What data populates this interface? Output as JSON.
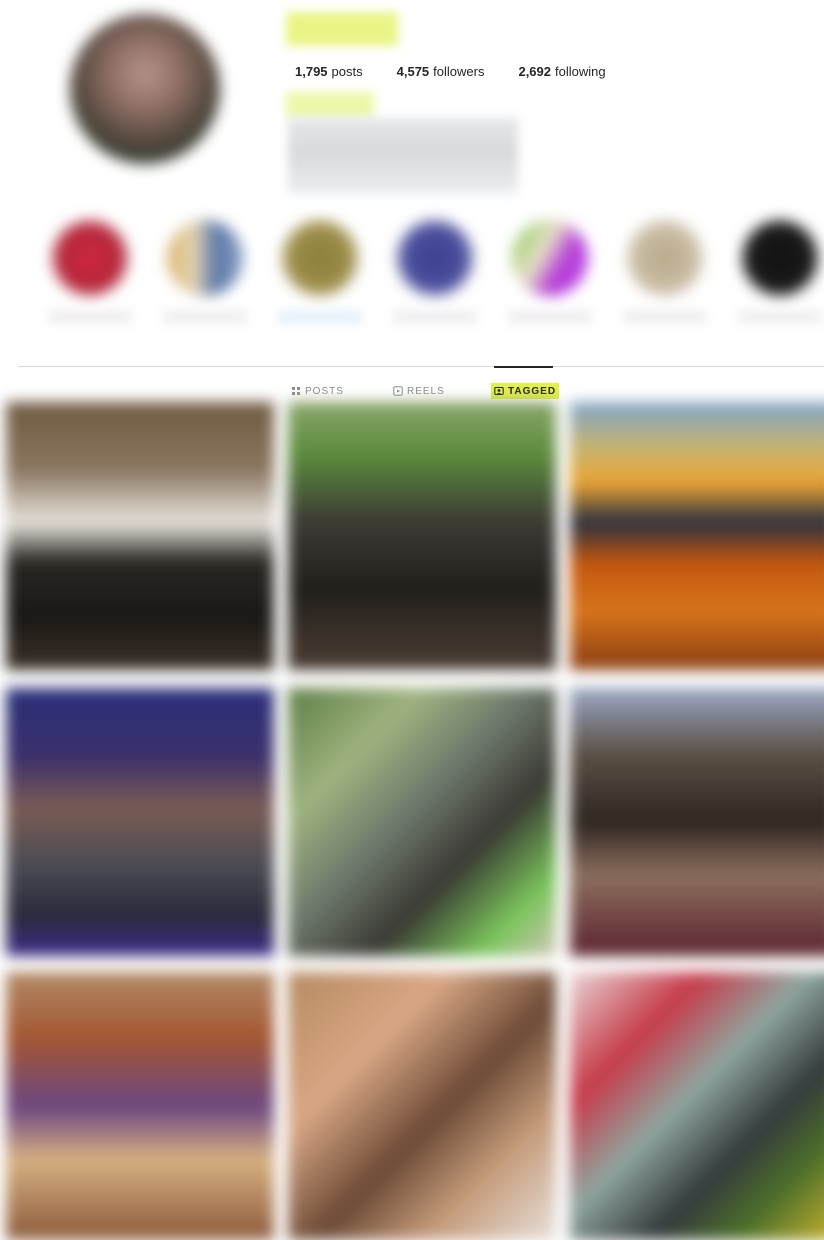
{
  "profile": {
    "stats": [
      {
        "count": "1,795",
        "label": "posts"
      },
      {
        "count": "4,575",
        "label": "followers"
      },
      {
        "count": "2,692",
        "label": "following"
      }
    ]
  },
  "tabs": [
    {
      "label": "POSTS",
      "icon": "grid-icon",
      "active": false
    },
    {
      "label": "REELS",
      "icon": "reels-icon",
      "active": false
    },
    {
      "label": "TAGGED",
      "icon": "tagged-icon",
      "active": true
    }
  ],
  "colors": {
    "highlight": "#e3f04a",
    "text": "#262626",
    "muted": "#8e8e8e",
    "divider": "#dbdbdb"
  }
}
